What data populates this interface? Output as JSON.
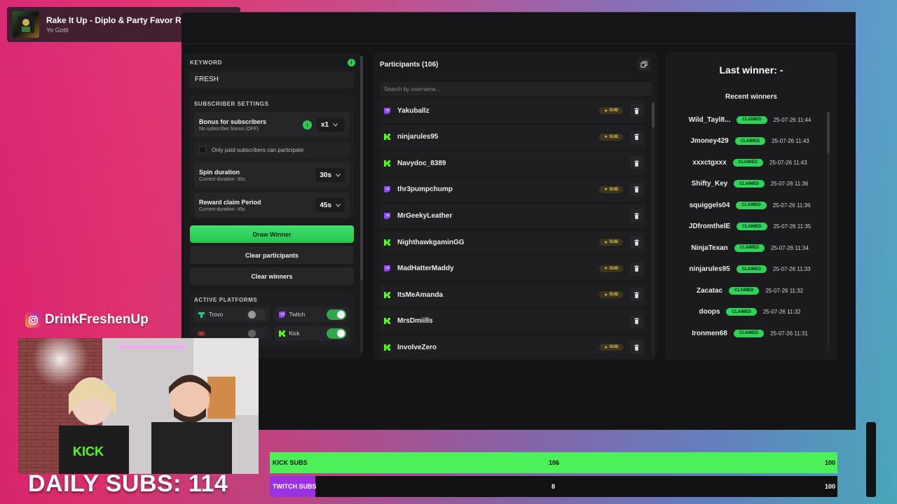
{
  "now_playing": {
    "title": "Rake It Up - Diplo & Party Favor Remix",
    "artist": "Yo Gotti"
  },
  "settings": {
    "keyword_label": "KEYWORD",
    "keyword_value": "FRESH",
    "subscriber_settings_label": "SUBSCRIBER SETTINGS",
    "bonus": {
      "title": "Bonus for subscribers",
      "subtitle": "No subscriber bonus (OFF)",
      "value": "x1"
    },
    "paid_only_label": "Only paid subscribers can participate",
    "spin": {
      "title": "Spin duration",
      "subtitle": "Current duration: 30s",
      "value": "30s"
    },
    "claim": {
      "title": "Reward claim Period",
      "subtitle": "Current duration: 45s",
      "value": "45s"
    },
    "draw_button": "Draw Winner",
    "clear_participants_button": "Clear participants",
    "clear_winners_button": "Clear winners",
    "active_platforms_label": "ACTIVE PLATFORMS",
    "platforms": [
      {
        "name": "Trovo",
        "enabled": false,
        "color": "#22d17a"
      },
      {
        "name": "Twitch",
        "enabled": true,
        "color": "#9146ff"
      },
      {
        "name": "",
        "enabled": false,
        "color": "#d33"
      },
      {
        "name": "Kick",
        "enabled": true,
        "color": "#53fc18"
      }
    ]
  },
  "participants": {
    "title": "Participants (106)",
    "search_placeholder": "Search by username...",
    "sub_label": "SUB",
    "rows": [
      {
        "name": "Yakuballz",
        "platform": "twitch",
        "sub": true
      },
      {
        "name": "ninjarules95",
        "platform": "kick",
        "sub": true
      },
      {
        "name": "Navydoc_8389",
        "platform": "kick",
        "sub": false
      },
      {
        "name": "thr3pumpchump",
        "platform": "twitch",
        "sub": true
      },
      {
        "name": "MrGeekyLeather",
        "platform": "twitch",
        "sub": false
      },
      {
        "name": "NighthawkgaminGG",
        "platform": "kick",
        "sub": true
      },
      {
        "name": "MadHatterMaddy",
        "platform": "twitch",
        "sub": true
      },
      {
        "name": "ItsMeAmanda",
        "platform": "kick",
        "sub": true
      },
      {
        "name": "MrsDmiills",
        "platform": "kick",
        "sub": false
      },
      {
        "name": "InvolveZero",
        "platform": "kick",
        "sub": true
      }
    ]
  },
  "winners": {
    "last_winner": "Last winner: -",
    "recent_title": "Recent winners",
    "claimed_label": "CLAIMED",
    "rows": [
      {
        "name": "Wild_Tayl8...",
        "date": "25-07-26 11:44"
      },
      {
        "name": "Jmoney429",
        "date": "25-07-26 11:43"
      },
      {
        "name": "xxxctgxxx",
        "date": "25-07-26 11:43"
      },
      {
        "name": "Shifty_Key",
        "date": "25-07-26 11:36"
      },
      {
        "name": "squiggels04",
        "date": "25-07-26 11:36"
      },
      {
        "name": "JDfromthelE",
        "date": "25-07-26 11:35"
      },
      {
        "name": "NinjaTexan",
        "date": "25-07-26 11:34"
      },
      {
        "name": "ninjarules95",
        "date": "25-07-26 11:33"
      },
      {
        "name": "Zacatac",
        "date": "25-07-26 11:32"
      },
      {
        "name": "doops",
        "date": "25-07-26 11:32"
      },
      {
        "name": "Ironmen68",
        "date": "25-07-26 11:31"
      }
    ]
  },
  "overlay": {
    "instagram_handle": "DrinkFreshenUp",
    "daily_subs": "DAILY SUBS: 114"
  },
  "goals": [
    {
      "label": "KICK SUBS",
      "count": 106,
      "max": 100,
      "color": "#4ef05a"
    },
    {
      "label": "TWITCH SUBS",
      "count": 8,
      "max": 100,
      "color": "#9b32e0"
    }
  ],
  "colors": {
    "accent_green": "#2ecc52",
    "twitch_purple": "#9146ff",
    "kick_green": "#53fc18",
    "sub_gold": "#e2c64a"
  }
}
